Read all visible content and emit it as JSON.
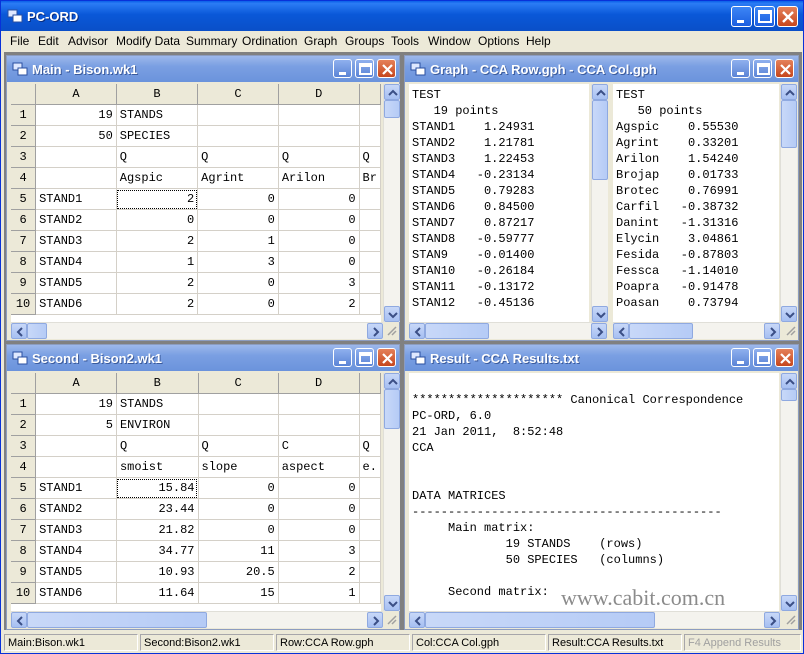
{
  "app": {
    "title": "PC-ORD",
    "menu": [
      "File",
      "Edit",
      "Advisor",
      "Modify Data",
      "Summary",
      "Ordination",
      "Graph",
      "Groups",
      "Tools",
      "Window",
      "Options",
      "Help"
    ]
  },
  "colors": {
    "title_active": "#0a58d8",
    "title_inactive": "#7a9fe2",
    "close_red": "#c6461d"
  },
  "icons": [
    "app-icon",
    "minimize-icon",
    "maximize-icon",
    "close-icon",
    "scroll-up-icon",
    "scroll-down-icon",
    "scroll-left-icon",
    "scroll-right-icon",
    "grip-icon"
  ],
  "main_window": {
    "title": "Main - Bison.wk1",
    "columns": [
      "A",
      "B",
      "C",
      "D"
    ],
    "rows": [
      {
        "n": "1",
        "a": "19",
        "b": "STANDS",
        "c": "",
        "d": "",
        "e": ""
      },
      {
        "n": "2",
        "a": "50",
        "b": "SPECIES",
        "c": "",
        "d": "",
        "e": ""
      },
      {
        "n": "3",
        "a": "",
        "b": "Q",
        "c": "Q",
        "d": "Q",
        "e": "Q"
      },
      {
        "n": "4",
        "a": "",
        "b": "Agspic",
        "c": "Agrint",
        "d": "Arilon",
        "e": "Br"
      },
      {
        "n": "5",
        "a": "STAND1",
        "b": "2",
        "c": "0",
        "d": "0",
        "e": ""
      },
      {
        "n": "6",
        "a": "STAND2",
        "b": "0",
        "c": "0",
        "d": "0",
        "e": ""
      },
      {
        "n": "7",
        "a": "STAND3",
        "b": "2",
        "c": "1",
        "d": "0",
        "e": ""
      },
      {
        "n": "8",
        "a": "STAND4",
        "b": "1",
        "c": "3",
        "d": "0",
        "e": ""
      },
      {
        "n": "9",
        "a": "STAND5",
        "b": "2",
        "c": "0",
        "d": "3",
        "e": ""
      },
      {
        "n": "10",
        "a": "STAND6",
        "b": "2",
        "c": "0",
        "d": "2",
        "e": ""
      }
    ]
  },
  "graph_window": {
    "title": "Graph - CCA Row.gph - CCA Col.gph",
    "row_pane": {
      "header": "TEST",
      "count": "19 points",
      "items": [
        [
          "STAND1",
          "1.24931"
        ],
        [
          "STAND2",
          "1.21781"
        ],
        [
          "STAND3",
          "1.22453"
        ],
        [
          "STAND4",
          "-0.23134"
        ],
        [
          "STAND5",
          "0.79283"
        ],
        [
          "STAND6",
          "0.84500"
        ],
        [
          "STAND7",
          "0.87217"
        ],
        [
          "STAND8",
          "-0.59777"
        ],
        [
          "STAN9",
          "-0.01400"
        ],
        [
          "STAN10",
          "-0.26184"
        ],
        [
          "STAN11",
          "-0.13172"
        ],
        [
          "STAN12",
          "-0.45136"
        ]
      ]
    },
    "col_pane": {
      "header": "TEST",
      "count": "50 points",
      "items": [
        [
          "Agspic",
          "0.55530"
        ],
        [
          "Agrint",
          "0.33201"
        ],
        [
          "Arilon",
          "1.54240"
        ],
        [
          "Brojap",
          "0.01733"
        ],
        [
          "Brotec",
          "0.76991"
        ],
        [
          "Carfil",
          "-0.38732"
        ],
        [
          "Danint",
          "-1.31316"
        ],
        [
          "Elycin",
          "3.04861"
        ],
        [
          "Fesida",
          "-0.87803"
        ],
        [
          "Fessca",
          "-1.14010"
        ],
        [
          "Poapra",
          "-0.91478"
        ],
        [
          "Poasan",
          "0.73794"
        ]
      ]
    }
  },
  "second_window": {
    "title": "Second - Bison2.wk1",
    "columns": [
      "A",
      "B",
      "C",
      "D"
    ],
    "rows": [
      {
        "n": "1",
        "a": "19",
        "b": "STANDS",
        "c": "",
        "d": "",
        "e": ""
      },
      {
        "n": "2",
        "a": "5",
        "b": "ENVIRON",
        "c": "",
        "d": "",
        "e": ""
      },
      {
        "n": "3",
        "a": "",
        "b": "Q",
        "c": "Q",
        "d": "C",
        "e": "Q"
      },
      {
        "n": "4",
        "a": "",
        "b": "smoist",
        "c": "slope",
        "d": "aspect",
        "e": "e."
      },
      {
        "n": "5",
        "a": "STAND1",
        "b": "15.84",
        "c": "0",
        "d": "0",
        "e": ""
      },
      {
        "n": "6",
        "a": "STAND2",
        "b": "23.44",
        "c": "0",
        "d": "0",
        "e": ""
      },
      {
        "n": "7",
        "a": "STAND3",
        "b": "21.82",
        "c": "0",
        "d": "0",
        "e": ""
      },
      {
        "n": "8",
        "a": "STAND4",
        "b": "34.77",
        "c": "11",
        "d": "3",
        "e": ""
      },
      {
        "n": "9",
        "a": "STAND5",
        "b": "10.93",
        "c": "20.5",
        "d": "2",
        "e": ""
      },
      {
        "n": "10",
        "a": "STAND6",
        "b": "11.64",
        "c": "15",
        "d": "1",
        "e": ""
      }
    ]
  },
  "result_window": {
    "title": "Result - CCA Results.txt",
    "lines": [
      "",
      "********************* Canonical Correspondence",
      "PC-ORD, 6.0",
      "21 Jan 2011,  8:52:48",
      "CCA",
      "",
      "",
      "DATA MATRICES",
      "-------------------------------------------",
      "     Main matrix:",
      "             19 STANDS    (rows)",
      "             50 SPECIES   (columns)",
      "",
      "     Second matrix:"
    ]
  },
  "status": {
    "main": "Main:Bison.wk1",
    "second": "Second:Bison2.wk1",
    "row": "Row:CCA Row.gph",
    "col": "Col:CCA Col.gph",
    "result": "Result:CCA Results.txt",
    "append": "F4 Append Results"
  },
  "watermark": "www.cabit.com.cn"
}
